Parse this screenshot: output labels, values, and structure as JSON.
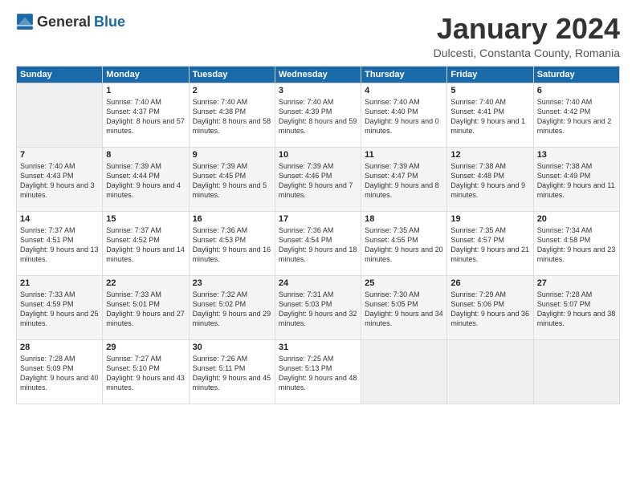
{
  "header": {
    "logo_general": "General",
    "logo_blue": "Blue",
    "month_title": "January 2024",
    "location": "Dulcesti, Constanta County, Romania"
  },
  "days_of_week": [
    "Sunday",
    "Monday",
    "Tuesday",
    "Wednesday",
    "Thursday",
    "Friday",
    "Saturday"
  ],
  "weeks": [
    [
      {
        "day": "",
        "empty": true
      },
      {
        "day": "1",
        "sunrise": "7:40 AM",
        "sunset": "4:37 PM",
        "daylight": "8 hours and 57 minutes."
      },
      {
        "day": "2",
        "sunrise": "7:40 AM",
        "sunset": "4:38 PM",
        "daylight": "8 hours and 58 minutes."
      },
      {
        "day": "3",
        "sunrise": "7:40 AM",
        "sunset": "4:39 PM",
        "daylight": "8 hours and 59 minutes."
      },
      {
        "day": "4",
        "sunrise": "7:40 AM",
        "sunset": "4:40 PM",
        "daylight": "9 hours and 0 minutes."
      },
      {
        "day": "5",
        "sunrise": "7:40 AM",
        "sunset": "4:41 PM",
        "daylight": "9 hours and 1 minute."
      },
      {
        "day": "6",
        "sunrise": "7:40 AM",
        "sunset": "4:42 PM",
        "daylight": "9 hours and 2 minutes."
      }
    ],
    [
      {
        "day": "7",
        "sunrise": "7:40 AM",
        "sunset": "4:43 PM",
        "daylight": "9 hours and 3 minutes."
      },
      {
        "day": "8",
        "sunrise": "7:39 AM",
        "sunset": "4:44 PM",
        "daylight": "9 hours and 4 minutes."
      },
      {
        "day": "9",
        "sunrise": "7:39 AM",
        "sunset": "4:45 PM",
        "daylight": "9 hours and 5 minutes."
      },
      {
        "day": "10",
        "sunrise": "7:39 AM",
        "sunset": "4:46 PM",
        "daylight": "9 hours and 7 minutes."
      },
      {
        "day": "11",
        "sunrise": "7:39 AM",
        "sunset": "4:47 PM",
        "daylight": "9 hours and 8 minutes."
      },
      {
        "day": "12",
        "sunrise": "7:38 AM",
        "sunset": "4:48 PM",
        "daylight": "9 hours and 9 minutes."
      },
      {
        "day": "13",
        "sunrise": "7:38 AM",
        "sunset": "4:49 PM",
        "daylight": "9 hours and 11 minutes."
      }
    ],
    [
      {
        "day": "14",
        "sunrise": "7:37 AM",
        "sunset": "4:51 PM",
        "daylight": "9 hours and 13 minutes."
      },
      {
        "day": "15",
        "sunrise": "7:37 AM",
        "sunset": "4:52 PM",
        "daylight": "9 hours and 14 minutes."
      },
      {
        "day": "16",
        "sunrise": "7:36 AM",
        "sunset": "4:53 PM",
        "daylight": "9 hours and 16 minutes."
      },
      {
        "day": "17",
        "sunrise": "7:36 AM",
        "sunset": "4:54 PM",
        "daylight": "9 hours and 18 minutes."
      },
      {
        "day": "18",
        "sunrise": "7:35 AM",
        "sunset": "4:55 PM",
        "daylight": "9 hours and 20 minutes."
      },
      {
        "day": "19",
        "sunrise": "7:35 AM",
        "sunset": "4:57 PM",
        "daylight": "9 hours and 21 minutes."
      },
      {
        "day": "20",
        "sunrise": "7:34 AM",
        "sunset": "4:58 PM",
        "daylight": "9 hours and 23 minutes."
      }
    ],
    [
      {
        "day": "21",
        "sunrise": "7:33 AM",
        "sunset": "4:59 PM",
        "daylight": "9 hours and 25 minutes."
      },
      {
        "day": "22",
        "sunrise": "7:33 AM",
        "sunset": "5:01 PM",
        "daylight": "9 hours and 27 minutes."
      },
      {
        "day": "23",
        "sunrise": "7:32 AM",
        "sunset": "5:02 PM",
        "daylight": "9 hours and 29 minutes."
      },
      {
        "day": "24",
        "sunrise": "7:31 AM",
        "sunset": "5:03 PM",
        "daylight": "9 hours and 32 minutes."
      },
      {
        "day": "25",
        "sunrise": "7:30 AM",
        "sunset": "5:05 PM",
        "daylight": "9 hours and 34 minutes."
      },
      {
        "day": "26",
        "sunrise": "7:29 AM",
        "sunset": "5:06 PM",
        "daylight": "9 hours and 36 minutes."
      },
      {
        "day": "27",
        "sunrise": "7:28 AM",
        "sunset": "5:07 PM",
        "daylight": "9 hours and 38 minutes."
      }
    ],
    [
      {
        "day": "28",
        "sunrise": "7:28 AM",
        "sunset": "5:09 PM",
        "daylight": "9 hours and 40 minutes."
      },
      {
        "day": "29",
        "sunrise": "7:27 AM",
        "sunset": "5:10 PM",
        "daylight": "9 hours and 43 minutes."
      },
      {
        "day": "30",
        "sunrise": "7:26 AM",
        "sunset": "5:11 PM",
        "daylight": "9 hours and 45 minutes."
      },
      {
        "day": "31",
        "sunrise": "7:25 AM",
        "sunset": "5:13 PM",
        "daylight": "9 hours and 48 minutes."
      },
      {
        "day": "",
        "empty": true
      },
      {
        "day": "",
        "empty": true
      },
      {
        "day": "",
        "empty": true
      }
    ]
  ]
}
